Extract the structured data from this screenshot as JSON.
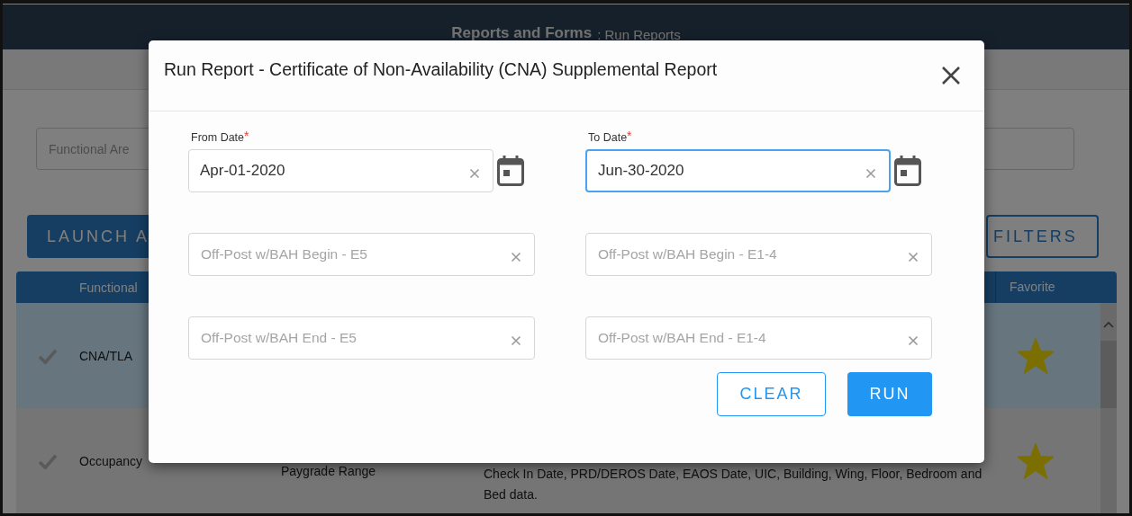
{
  "header": {
    "title": "Reports and Forms",
    "subtitle": ": Run Reports"
  },
  "filter_field": {
    "placeholder": "Functional Are"
  },
  "buttons": [
    {
      "label": "LAUNCH A",
      "kind": "filled"
    },
    {
      "label": "FILTERS",
      "kind": "outlined"
    }
  ],
  "table": {
    "columns": [
      "Functional",
      "Favorite"
    ],
    "rows": [
      {
        "selected": true,
        "area": "CNA/TLA",
        "favorite": true
      },
      {
        "selected": false,
        "area": "Occupancy",
        "column_3": "Paygrade Range",
        "column_4": "Check In Date, PRD/DEROS Date, EAOS Date, UIC, Building, Wing, Floor, Bedroom and Bed data.",
        "favorite": true
      }
    ]
  },
  "dialog": {
    "title": "Run Report - Certificate of Non-Availability (CNA) Supplemental Report",
    "fields": [
      {
        "kind": "date",
        "label": "From Date",
        "required_mark": "*",
        "value": "Apr-01-2020",
        "focused": false
      },
      {
        "kind": "date",
        "label": "To Date",
        "required_mark": "*",
        "value": "Jun-30-2020",
        "focused": true
      },
      {
        "kind": "text",
        "placeholder": "Off-Post w/BAH Begin - E5",
        "focused": false
      },
      {
        "kind": "text",
        "placeholder": "Off-Post w/BAH Begin - E1-4",
        "focused": false
      },
      {
        "kind": "text",
        "placeholder": "Off-Post w/BAH End - E5",
        "focused": false
      },
      {
        "kind": "text",
        "placeholder": "Off-Post w/BAH End - E1-4",
        "focused": false
      }
    ],
    "buttons": [
      {
        "label": "CLEAR",
        "kind": "outlined"
      },
      {
        "label": "RUN",
        "kind": "filled"
      }
    ]
  }
}
